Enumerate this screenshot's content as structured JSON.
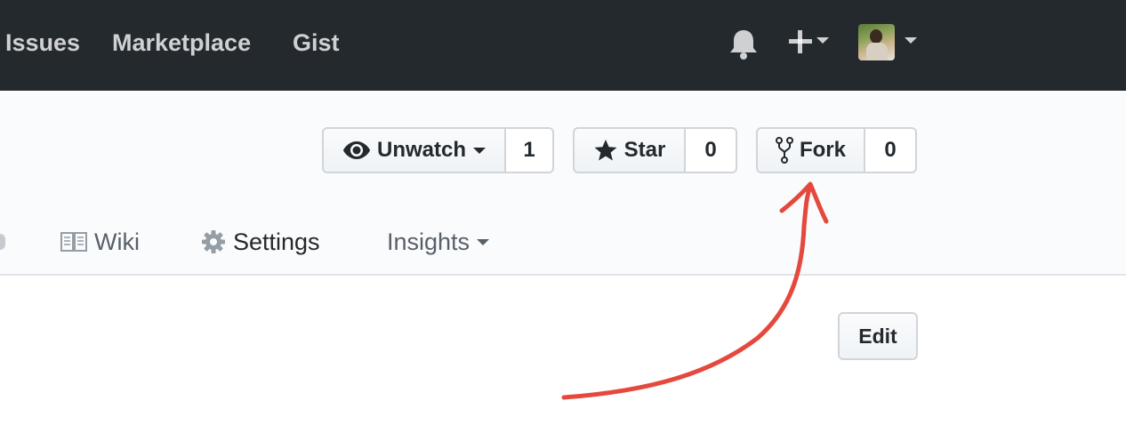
{
  "header": {
    "nav": [
      "Issues",
      "Marketplace",
      "Gist"
    ],
    "icons": {
      "notifications": "bell-icon",
      "create": "plus-icon",
      "user_menu": "avatar"
    }
  },
  "repo": {
    "watch": {
      "label": "Unwatch",
      "count": "1"
    },
    "star": {
      "label": "Star",
      "count": "0"
    },
    "fork": {
      "label": "Fork",
      "count": "0"
    }
  },
  "tabs": [
    {
      "label": "Wiki",
      "icon": "book-icon"
    },
    {
      "label": "Settings",
      "icon": "gear-icon"
    },
    {
      "label": "Insights",
      "icon": "chevron-down-icon"
    }
  ],
  "content": {
    "edit_label": "Edit"
  },
  "colors": {
    "header_bg": "#24292e",
    "repohead_bg": "#fafbfc",
    "annotation_arrow": "#e5483c"
  }
}
